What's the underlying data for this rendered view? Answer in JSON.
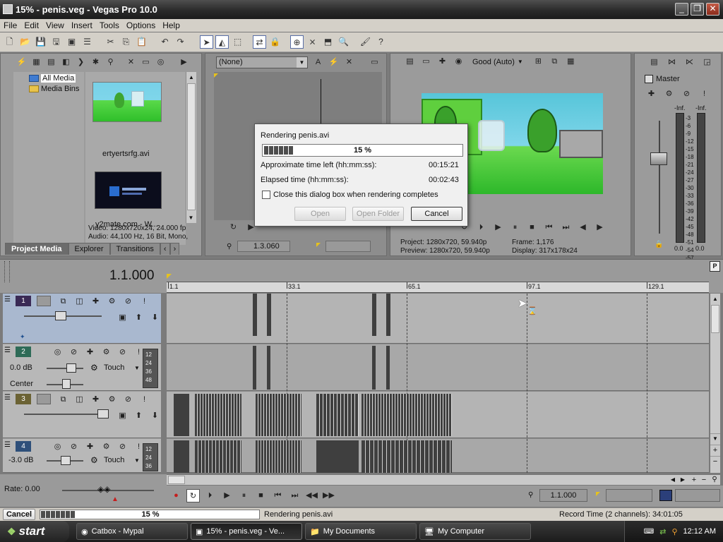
{
  "window": {
    "title": "15% - penis.veg - Vegas Pro 10.0"
  },
  "menu": [
    "File",
    "Edit",
    "View",
    "Insert",
    "Tools",
    "Options",
    "Help"
  ],
  "explorer": {
    "tree": [
      "All Media",
      "Media Bins"
    ],
    "items": [
      "ertyertsrfg.avi",
      "y2mate.com - W..."
    ],
    "info": [
      "Video: 1280x720x24, 24.000 fp",
      "Audio: 44,100 Hz, 16 Bit, Mono,"
    ],
    "tabs": [
      "Project Media",
      "Explorer",
      "Transitions"
    ]
  },
  "trimmer": {
    "select": "(None)",
    "time": "1.3.060"
  },
  "preview": {
    "quality": "Good (Auto)",
    "project_label": "Project:",
    "project": "1280x720, 59.940p",
    "preview_label": "Preview:",
    "preview_val": "1280x720, 59.940p",
    "frame_label": "Frame:",
    "frame": "1,176",
    "display_label": "Display:",
    "display": "317x178x24"
  },
  "mixer": {
    "master": "Master",
    "left": "-Inf.",
    "right": "-Inf.",
    "scale": [
      "3",
      "6",
      "9",
      "12",
      "15",
      "18",
      "21",
      "24",
      "27",
      "30",
      "33",
      "36",
      "39",
      "42",
      "45",
      "48",
      "51",
      "54",
      "57"
    ],
    "bottom_l": "0.0",
    "bottom_r": "0.0"
  },
  "dialog": {
    "title": "Rendering penis.avi",
    "percent": "15 %",
    "progress": 0.15,
    "time_left_label": "Approximate time left (hh:mm:ss):",
    "time_left": "00:15:21",
    "elapsed_label": "Elapsed time (hh:mm:ss):",
    "elapsed": "00:02:43",
    "checkbox_label": "Close this dialog box when rendering completes",
    "open": "Open",
    "open_folder": "Open Folder",
    "cancel": "Cancel"
  },
  "timeline": {
    "cursor": "1.1.000",
    "ruler": [
      "1.1",
      "33.1",
      "65.1",
      "97.1",
      "129.1"
    ],
    "rate": "Rate: 0.00",
    "transport_time": "1.1.000"
  },
  "tracks": [
    {
      "no": "1",
      "color": "#3a2a55"
    },
    {
      "no": "2",
      "color": "#2e6b57",
      "vol": "0.0 dB",
      "pan": "Center",
      "mode": "Touch"
    },
    {
      "no": "3",
      "color": "#6b6234"
    },
    {
      "no": "4",
      "color": "#2e4f7a",
      "vol": "-3.0 dB",
      "mode": "Touch"
    }
  ],
  "meter_labels": [
    "12",
    "24",
    "36",
    "48"
  ],
  "status": {
    "cancel": "Cancel",
    "percent": "15 %",
    "progress": 0.15,
    "text": "Rendering penis.avi",
    "record": "Record Time (2 channels): 34:01:05"
  },
  "taskbar": {
    "start": "start",
    "tasks": [
      "Catbox - Mypal",
      "15% - penis.veg - Ve...",
      "My Documents",
      "My Computer"
    ],
    "clock": "12:12 AM"
  }
}
